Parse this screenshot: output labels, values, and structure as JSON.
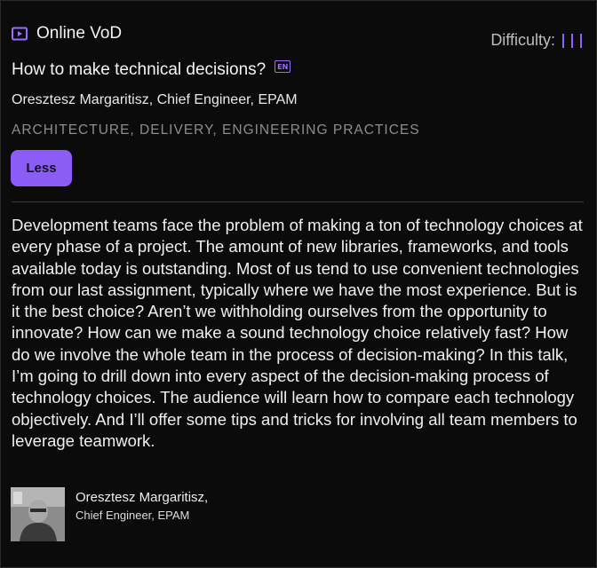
{
  "session": {
    "format_icon": "play-screen-icon",
    "format": "Online VoD",
    "difficulty_label": "Difficulty:",
    "difficulty_level": 3,
    "title": "How to make technical decisions?",
    "language_badge": "EN",
    "speaker_line": "Oresztesz Margaritisz, Chief Engineer, EPAM",
    "tags": "ARCHITECTURE, DELIVERY, ENGINEERING PRACTICES",
    "less_button": "Less",
    "description": "Development teams face the problem of making a ton of technology choices at every phase of a project. The amount of new libraries, frameworks, and tools available today is outstanding. Most of us tend to use convenient technologies from our last assignment, typically where we have the most experience. But is it the best choice? Aren’t we withholding ourselves from the opportunity to innovate? How can we make a sound technology choice relatively fast? How do we involve the whole team in the process of decision-making? In this talk, I’m going to drill down into every aspect of the decision-making process of technology choices. The audience will learn how to compare each technology objectively. And I’ll offer some tips and tricks for involving all team members to leverage teamwork."
  },
  "speaker": {
    "name": "Oresztesz Margaritisz,",
    "role": "Chief Engineer, EPAM"
  },
  "colors": {
    "accent": "#8b5cf6",
    "background": "#0b0b0b",
    "tag_text": "#8d8d8d"
  }
}
